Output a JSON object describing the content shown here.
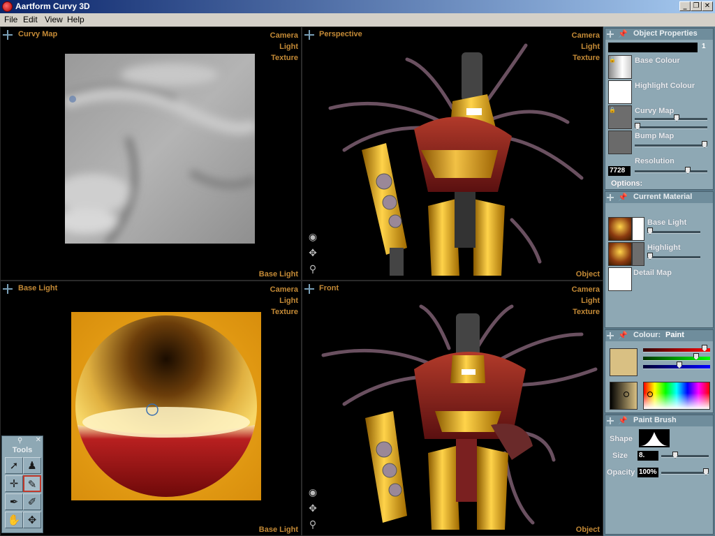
{
  "window": {
    "title": "Aartform Curvy 3D",
    "min_glyph": "_",
    "max_glyph": "❐",
    "close_glyph": "✕"
  },
  "menu": [
    "File",
    "Edit",
    "View",
    "Help"
  ],
  "viewports": {
    "curvy_map": {
      "title": "Curvy Map",
      "options": [
        "Camera",
        "Light",
        "Texture"
      ],
      "footer": "Base Light"
    },
    "perspective": {
      "title": "Perspective",
      "options": [
        "Camera",
        "Light",
        "Texture"
      ],
      "footer": "Object"
    },
    "base_light": {
      "title": "Base Light",
      "options": [
        "Camera",
        "Light",
        "Texture"
      ],
      "footer": "Base Light"
    },
    "front": {
      "title": "Front",
      "options": [
        "Camera",
        "Light",
        "Texture"
      ],
      "footer": "Object"
    }
  },
  "tools": {
    "title": "Tools"
  },
  "panels": {
    "object_properties": {
      "title": "Object Properties",
      "counter": "1",
      "base_colour": "Base Colour",
      "highlight_colour": "Highlight Colour",
      "curvy_map": "Curvy Map",
      "bump_map": "Bump Map",
      "resolution_label": "Resolution",
      "resolution_value": "7728",
      "options_label": "Options:"
    },
    "current_material": {
      "title": "Current Material",
      "base_light": "Base Light",
      "highlight": "Highlight",
      "detail_map": "Detail Map"
    },
    "colour": {
      "title": "Colour:",
      "mode": "Paint",
      "swatch": "#d9c083"
    },
    "paint_brush": {
      "title": "Paint Brush",
      "shape_label": "Shape",
      "size_label": "Size",
      "size_value": "8.",
      "opacity_label": "Opacity",
      "opacity_value": "100%"
    }
  },
  "colors": {
    "label_orange": "#c48a36",
    "panel_bg": "#8ea8b4",
    "panel_header": "#6f8d9c",
    "titlebar_start": "#0a246a",
    "titlebar_end": "#a6caf0"
  }
}
